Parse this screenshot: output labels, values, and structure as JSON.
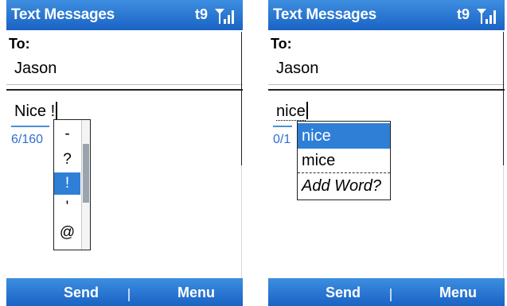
{
  "left": {
    "title": "Text Messages",
    "t9": "t9",
    "to_label": "To:",
    "to_value": "Jason",
    "message_text": "Nice ",
    "pending_char": "!",
    "counter": "6/160",
    "symbols": [
      "-",
      "?",
      "!",
      "'",
      "@"
    ],
    "selected_symbol": "!",
    "softkey_left": "Send",
    "softkey_right": "Menu"
  },
  "right": {
    "title": "Text Messages",
    "t9": "t9",
    "to_label": "To:",
    "to_value": "Jason",
    "message_text": "nice",
    "counter": "0/1",
    "suggestions": [
      "nice",
      "mice"
    ],
    "selected_suggestion": "nice",
    "add_word_label": "Add Word?",
    "softkey_left": "Send",
    "softkey_right": "Menu"
  },
  "colors": {
    "titlebar": "#1a63c4",
    "selection": "#2f7fd6",
    "counter": "#2f6fd0"
  }
}
